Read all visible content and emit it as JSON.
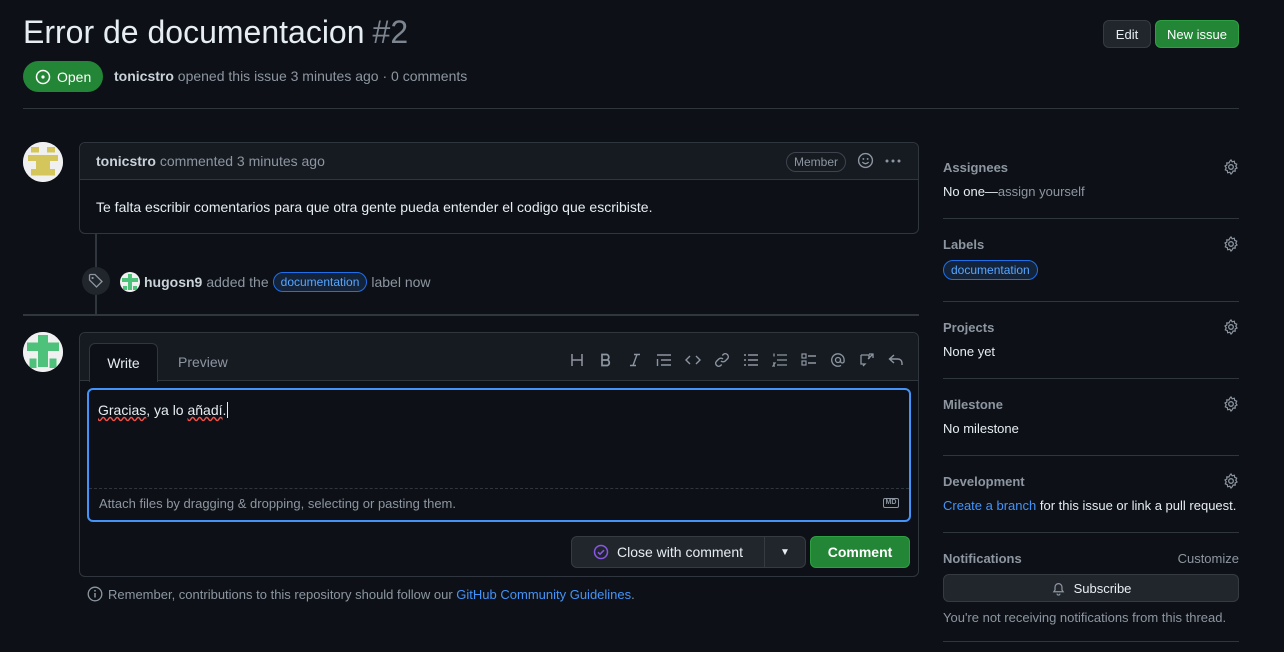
{
  "issue": {
    "title": "Error de documentacion",
    "number": "#2",
    "state": "Open",
    "author": "tonicstro",
    "meta_text": "opened this issue 3 minutes ago · 0 comments"
  },
  "header_buttons": {
    "edit": "Edit",
    "new_issue": "New issue"
  },
  "comment": {
    "author": "tonicstro",
    "action": "commented 3 minutes ago",
    "badge": "Member",
    "body": "Te falta escribir comentarios para que otra gente pueda entender el codigo que escribiste."
  },
  "event": {
    "actor": "hugosn9",
    "text_before": "added the",
    "label": "documentation",
    "text_after": "label now"
  },
  "editor": {
    "tab_write": "Write",
    "tab_preview": "Preview",
    "text_part1": "Gracias",
    "text_part2": ", ya lo ",
    "text_part3": "añadí",
    "text_part4": ".",
    "attach_hint": "Attach files by dragging & dropping, selecting or pasting them.",
    "markdown_badge": "MD"
  },
  "actions": {
    "close_with_comment": "Close with comment",
    "comment": "Comment"
  },
  "remember": {
    "text": "Remember, contributions to this repository should follow our",
    "link": "GitHub Community Guidelines",
    "end": "."
  },
  "sidebar": {
    "assignees": {
      "title": "Assignees",
      "value_prefix": "No one—",
      "value_link": "assign yourself"
    },
    "labels": {
      "title": "Labels",
      "label": "documentation"
    },
    "projects": {
      "title": "Projects",
      "value": "None yet"
    },
    "milestone": {
      "title": "Milestone",
      "value": "No milestone"
    },
    "development": {
      "title": "Development",
      "link": "Create a branch",
      "rest": " for this issue or link a pull request."
    },
    "notifications": {
      "title": "Notifications",
      "customize": "Customize",
      "subscribe": "Subscribe",
      "note": "You're not receiving notifications from this thread."
    }
  },
  "colors": {
    "background": "#0d1117",
    "green": "#238636",
    "accent_blue": "#4493f8",
    "border": "#30363d"
  }
}
